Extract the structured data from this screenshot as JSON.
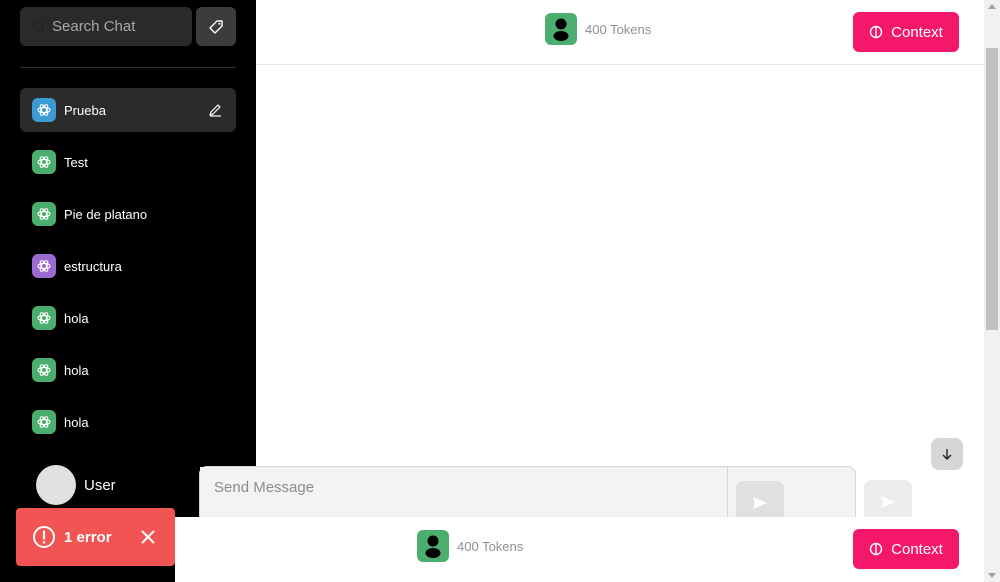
{
  "sidebar": {
    "search": {
      "placeholder": "Search Chat"
    },
    "chats": [
      {
        "label": "Prueba",
        "color": "#3d9bd4",
        "active": true
      },
      {
        "label": "Test",
        "color": "#4cae6e",
        "active": false
      },
      {
        "label": "Pie de platano",
        "color": "#4cae6e",
        "active": false
      },
      {
        "label": "estructura",
        "color": "#9a6bd1",
        "active": false
      },
      {
        "label": "hola",
        "color": "#4cae6e",
        "active": false
      },
      {
        "label": "hola",
        "color": "#4cae6e",
        "active": false
      },
      {
        "label": "hola",
        "color": "#4cae6e",
        "active": false
      }
    ],
    "user": {
      "name": "User"
    }
  },
  "toast": {
    "text": "1 error",
    "color": "#f25454"
  },
  "header": {
    "tokens": "400 Tokens",
    "context_label": "Context"
  },
  "composer": {
    "placeholder": "Send Message"
  },
  "footer": {
    "tokens": "400 Tokens",
    "context_label": "Context"
  },
  "colors": {
    "accent": "#f4176a",
    "token_avatar": "#4cae6e",
    "sidebar_bg": "#000000"
  },
  "icons": [
    "search-icon",
    "tag-icon",
    "openai-icon",
    "edit-icon",
    "person-icon",
    "brain-icon",
    "arrow-down-icon",
    "send-icon",
    "alert-icon",
    "close-icon"
  ]
}
